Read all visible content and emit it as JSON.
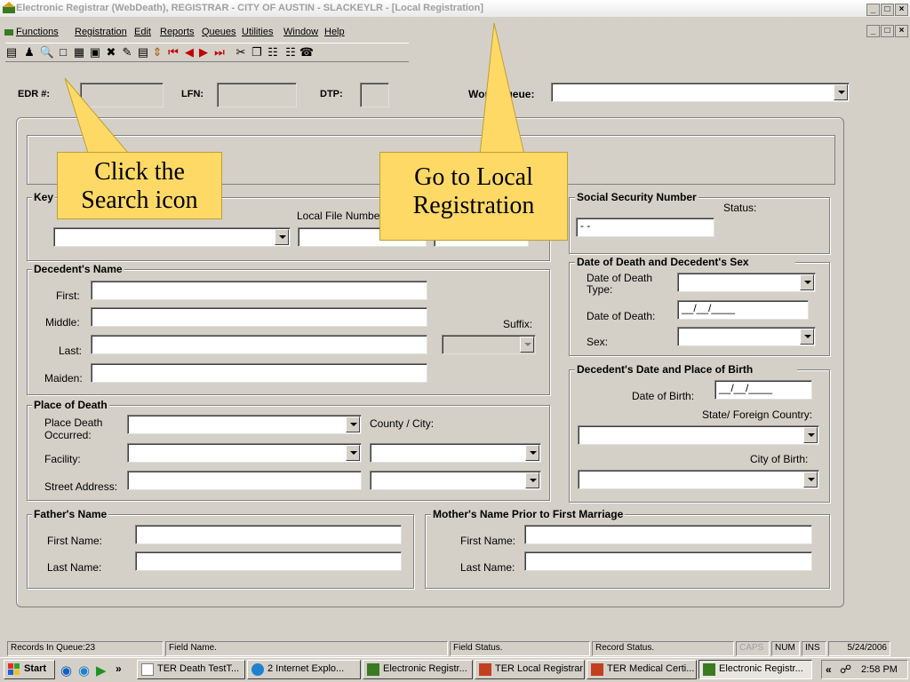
{
  "window": {
    "title": "Electronic Registrar (WebDeath), REGISTRAR - CITY OF AUSTIN - SLACKEYLR - [Local Registration]",
    "min": "_",
    "max": "□",
    "close": "×"
  },
  "menu": [
    "Functions",
    "Registration",
    "Edit",
    "Reports",
    "Queues",
    "Utilities",
    "Window",
    "Help"
  ],
  "header": {
    "edr_label": "EDR #:",
    "lfn_label": "LFN:",
    "dtp_label": "DTP:",
    "workqueue_label": "Work Queue:"
  },
  "callouts": {
    "search": "Click the Search icon",
    "local": "Go to Local Registration"
  },
  "key_section": {
    "title": "Key",
    "local_file_label": "Local File Number"
  },
  "ssn": {
    "title": "Social Security Number",
    "status_label": "Status:",
    "value": "- -"
  },
  "decedent_name": {
    "title": "Decedent's Name",
    "first": "First:",
    "middle": "Middle:",
    "last": "Last:",
    "maiden": "Maiden:",
    "suffix": "Suffix:"
  },
  "death_sex": {
    "title": "Date of Death and Decedent's Sex",
    "dod_type": "Date of Death Type:",
    "dod": "Date of Death:",
    "dod_value": "__/__/____",
    "sex": "Sex:"
  },
  "birth": {
    "title": "Decedent's Date and Place of Birth",
    "dob": "Date of Birth:",
    "dob_value": "__/__/____",
    "state": "State/ Foreign Country:",
    "city": "City of Birth:"
  },
  "place_death": {
    "title": "Place of Death",
    "occurred": "Place Death Occurred:",
    "county": "County / City:",
    "facility": "Facility:",
    "street": "Street Address:"
  },
  "father": {
    "title": "Father's Name",
    "first": "First Name:",
    "last": "Last Name:"
  },
  "mother": {
    "title": "Mother's Name Prior to First Marriage",
    "first": "First Name:",
    "last": "Last Name:"
  },
  "status": {
    "records": "Records In Queue:23",
    "field_name": "Field Name.",
    "field_status": "Field Status.",
    "record_status": "Record Status.",
    "caps": "CAPS",
    "num": "NUM",
    "ins": "INS",
    "date": "5/24/2006"
  },
  "taskbar": {
    "start": "Start",
    "chev": "»",
    "tasks": [
      "TER Death TestT...",
      "2 Internet Explo...",
      "Electronic Registr...",
      "TER Local Registrar",
      "TER Medical Certi...",
      "Electronic Registr..."
    ],
    "tray_chev": "«",
    "time": "2:58 PM"
  },
  "colors": {
    "callout": "#ffd966",
    "face": "#d4d0c8",
    "xp_blue": "#0a246a"
  }
}
